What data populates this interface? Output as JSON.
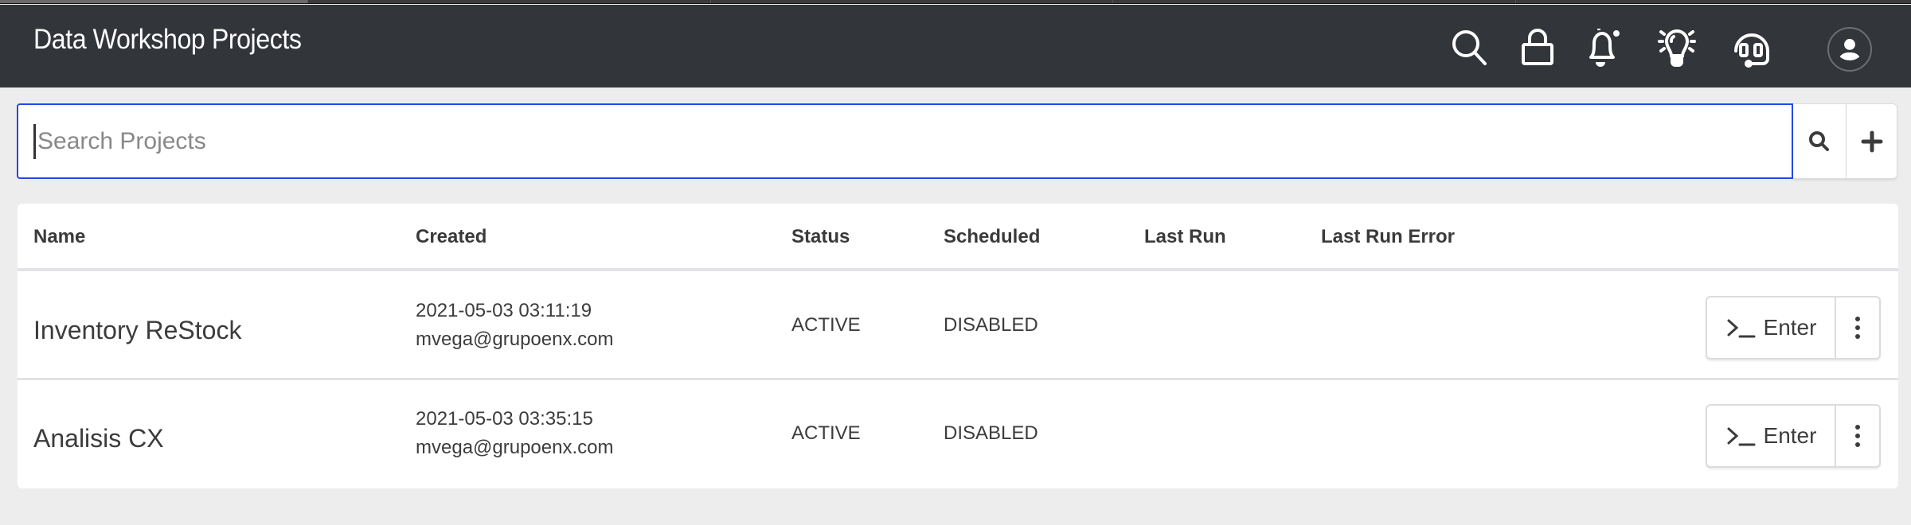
{
  "app": {
    "title": "Data Workshop Projects"
  },
  "header_icons": [
    {
      "name": "search-icon",
      "label": "Search"
    },
    {
      "name": "lock-icon",
      "label": "Lock"
    },
    {
      "name": "bell-icon",
      "label": "Notifications",
      "has_badge": true
    },
    {
      "name": "lightbulb-icon",
      "label": "Ideas"
    },
    {
      "name": "headset-icon",
      "label": "Support"
    },
    {
      "name": "user-avatar-icon",
      "label": "Account"
    }
  ],
  "search": {
    "placeholder": "Search Projects",
    "value": "",
    "search_button_icon": "search-icon",
    "add_button_icon": "plus-icon"
  },
  "table": {
    "columns": [
      "Name",
      "Created",
      "Status",
      "Scheduled",
      "Last Run",
      "Last Run Error"
    ],
    "rows": [
      {
        "name": "Inventory ReStock",
        "created_date": "2021-05-03 03:11:19",
        "created_by": "mvega@grupoenx.com",
        "status": "ACTIVE",
        "scheduled": "DISABLED",
        "last_run": "",
        "last_run_error": "",
        "enter_label": "Enter"
      },
      {
        "name": "Analisis CX",
        "created_date": "2021-05-03 03:35:15",
        "created_by": "mvega@grupoenx.com",
        "status": "ACTIVE",
        "scheduled": "DISABLED",
        "last_run": "",
        "last_run_error": "",
        "enter_label": "Enter"
      }
    ]
  },
  "colors": {
    "header_bg": "#32353a",
    "page_bg": "#ededed",
    "focus_border": "#2548e6",
    "text": "#3a3a3a"
  }
}
